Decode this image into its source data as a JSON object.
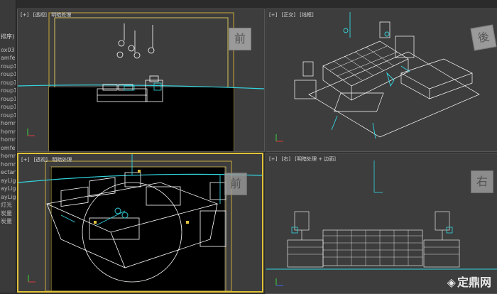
{
  "sidebar": {
    "header": "排序)",
    "items": [
      "ox03",
      "amfe",
      "roup1",
      "roup1",
      "roup1",
      "roup1",
      "roup1",
      "roup1",
      "roup1",
      "homm",
      "homm",
      "homm",
      "omfe",
      "homm",
      "homm",
      "ectan",
      "ayLig",
      "ayLig",
      "ayLig",
      "灯光",
      "炭量",
      "炭量"
    ]
  },
  "viewports": {
    "top_left": {
      "plus": "[+]",
      "view": "[透视]",
      "mode": "明暗处理"
    },
    "top_right": {
      "plus": "[+]",
      "view": "[正交]",
      "mode": "[线框]",
      "cube_label": "後"
    },
    "bottom_left": {
      "plus": "[+]",
      "view": "[透视]",
      "mode": "明暗处理"
    },
    "bottom_right": {
      "plus": "[+]",
      "view": "[右]",
      "mode": "[明暗处理 + 边面]",
      "cube_label": "右"
    }
  },
  "top_left_cube_label": "前",
  "bottom_left_cube_label": "前",
  "watermark": {
    "logo": "◈",
    "text": "定鼎网"
  },
  "colors": {
    "accent": "#e0c23a",
    "wire": "#ffffff",
    "cyan": "#33d6e0",
    "bg": "#3d3d3d"
  }
}
